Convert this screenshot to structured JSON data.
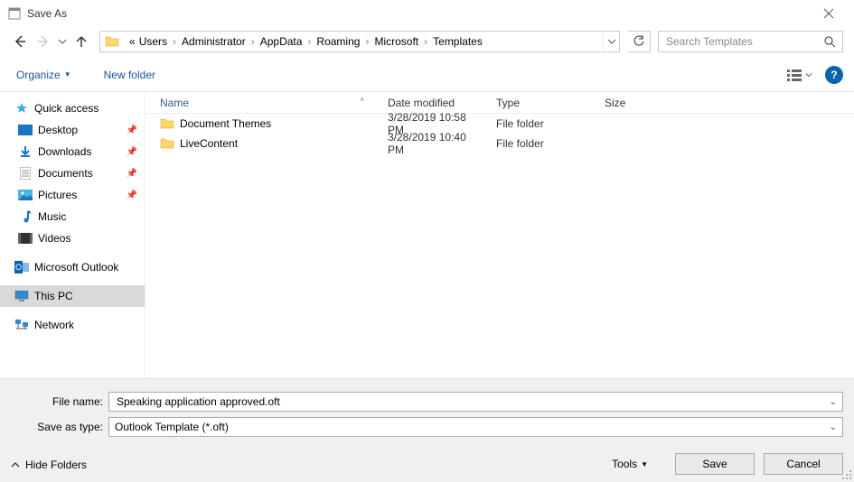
{
  "window": {
    "title": "Save As"
  },
  "nav": {},
  "address": {
    "prefix": "«",
    "crumbs": [
      "Users",
      "Administrator",
      "AppData",
      "Roaming",
      "Microsoft",
      "Templates"
    ]
  },
  "search": {
    "placeholder": "Search Templates"
  },
  "toolbar": {
    "organize": "Organize",
    "newfolder": "New folder",
    "help": "?"
  },
  "sidebar": {
    "quick": "Quick access",
    "desktop": "Desktop",
    "downloads": "Downloads",
    "documents": "Documents",
    "pictures": "Pictures",
    "music": "Music",
    "videos": "Videos",
    "outlook": "Microsoft Outlook",
    "thispc": "This PC",
    "network": "Network"
  },
  "columns": {
    "name": "Name",
    "date": "Date modified",
    "type": "Type",
    "size": "Size"
  },
  "rows": [
    {
      "name": "Document Themes",
      "date": "3/28/2019 10:58 PM",
      "type": "File folder"
    },
    {
      "name": "LiveContent",
      "date": "3/28/2019 10:40 PM",
      "type": "File folder"
    }
  ],
  "fields": {
    "filename_label": "File name:",
    "filename_value": "Speaking application approved.oft",
    "type_label": "Save as type:",
    "type_value": "Outlook Template (*.oft)"
  },
  "footer": {
    "hide": "Hide Folders",
    "tools": "Tools",
    "save": "Save",
    "cancel": "Cancel"
  }
}
